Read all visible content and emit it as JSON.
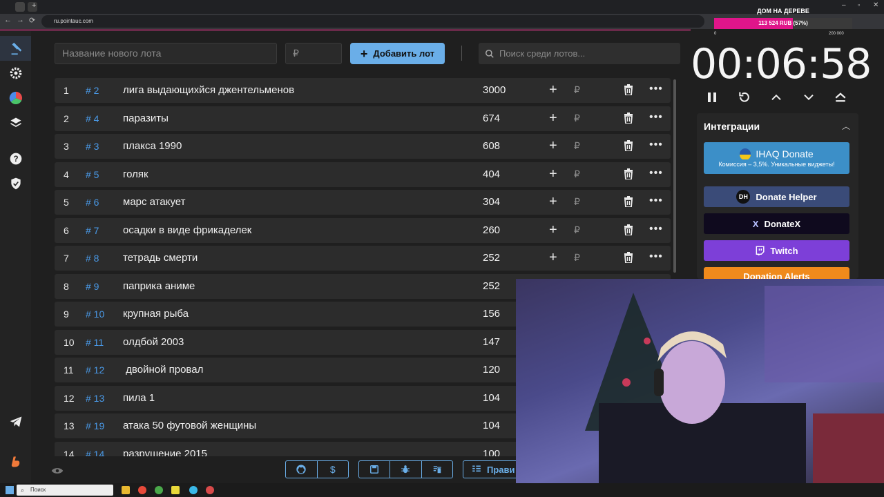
{
  "browser": {
    "url": "ru.pointauc.com",
    "back_icon": "←",
    "forward_icon": "→",
    "reload_icon": "⟳"
  },
  "donation_goal": {
    "title": "ДОМ НА ДЕРЕВЕ",
    "text": "113 524 RUB (57%)",
    "min": "0",
    "max": "200 000",
    "progress": 0.57,
    "color": "#e0158a"
  },
  "sidebar": {
    "icons": [
      "gavel-icon",
      "gear-icon",
      "pie-chart-icon",
      "layers-icon",
      "help-icon",
      "shield-icon",
      "telegram-icon",
      "boosty-icon"
    ]
  },
  "controls": {
    "lot_name_placeholder": "Название нового лота",
    "amount_placeholder": "₽",
    "add_label": "Добавить лот",
    "search_placeholder": "Поиск среди лотов..."
  },
  "lots": [
    {
      "index": "1",
      "id": "# 2",
      "name": "лига выдающихйся джентельменов",
      "amount": "3000"
    },
    {
      "index": "2",
      "id": "# 4",
      "name": "паразиты",
      "amount": "674"
    },
    {
      "index": "3",
      "id": "# 3",
      "name": "плакса 1990",
      "amount": "608"
    },
    {
      "index": "4",
      "id": "# 5",
      "name": "голяк",
      "amount": "404"
    },
    {
      "index": "5",
      "id": "# 6",
      "name": "марс атакует",
      "amount": "304"
    },
    {
      "index": "6",
      "id": "# 7",
      "name": "осадки в виде фрикаделек",
      "amount": "260"
    },
    {
      "index": "7",
      "id": "# 8",
      "name": "тетрадь смерти",
      "amount": "252"
    },
    {
      "index": "8",
      "id": "# 9",
      "name": "паприка аниме",
      "amount": "252"
    },
    {
      "index": "9",
      "id": "# 10",
      "name": "крупная рыба",
      "amount": "156"
    },
    {
      "index": "10",
      "id": "# 11",
      "name": "олдбой 2003",
      "amount": "147"
    },
    {
      "index": "11",
      "id": "# 12",
      "name": " двойной провал",
      "amount": "120"
    },
    {
      "index": "12",
      "id": "# 13",
      "name": "пила 1",
      "amount": "104"
    },
    {
      "index": "13",
      "id": "# 19",
      "name": "атака 50 футовой женщины",
      "amount": "104"
    },
    {
      "index": "14",
      "id": "# 14",
      "name": "разрушение 2015",
      "amount": "100"
    }
  ],
  "row_actions": {
    "plus": "+",
    "currency": "₽",
    "more": "•••"
  },
  "bottom": {
    "rules_label": "Прави"
  },
  "timer": {
    "value": "00:06:58"
  },
  "integrations": {
    "title": "Интеграции",
    "items": [
      {
        "name": "IHAQ Donate",
        "sub": "Комиссия – 3,5%. Уникальные виджеты!",
        "color": "#3c8fc8"
      },
      {
        "name": "Donate Helper",
        "color": "#3a4b78",
        "badge": "DH"
      },
      {
        "name": "DonateX",
        "color": "#0f0a1e",
        "badge": "X"
      },
      {
        "name": "Twitch",
        "color": "#7d3fd8"
      },
      {
        "name": "Donation Alerts",
        "color": "#f08a1c"
      }
    ]
  },
  "taskbar": {
    "search_placeholder": "Поиск"
  }
}
